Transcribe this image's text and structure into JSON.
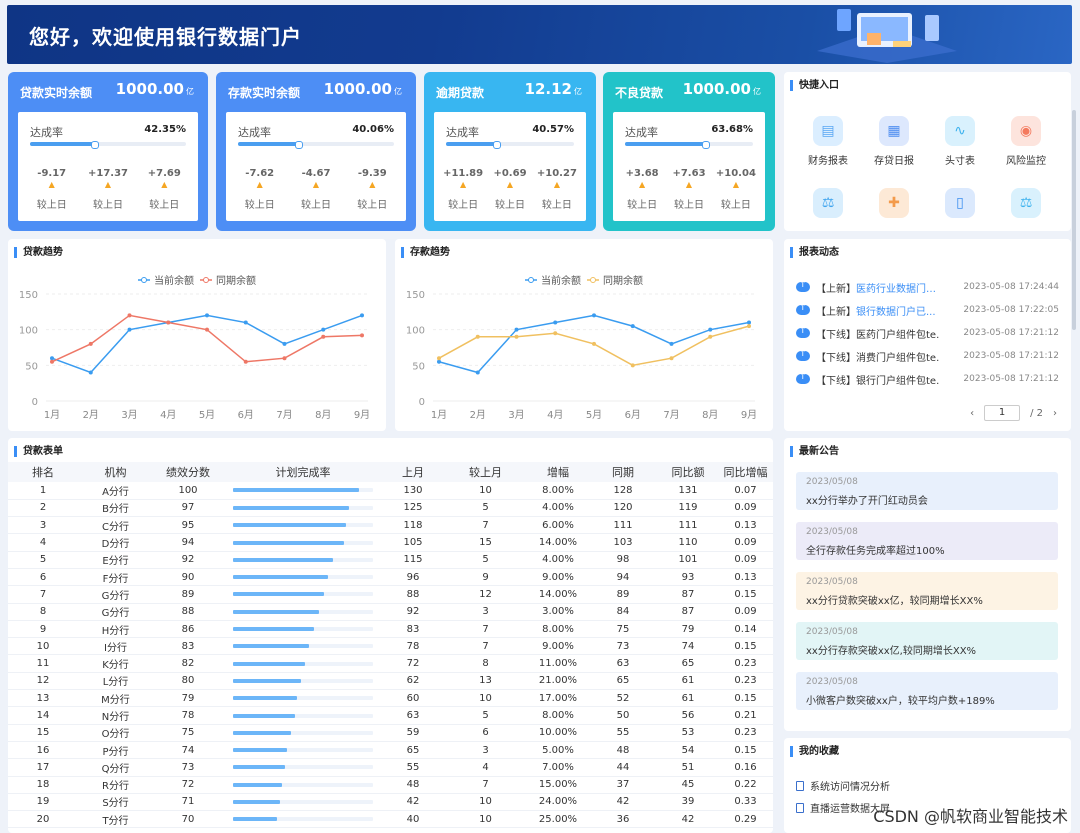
{
  "banner": {
    "greeting": "您好，欢迎使用银行数据门户"
  },
  "kpis": [
    {
      "title": "贷款实时余额",
      "value": "1000.00",
      "unit": "亿",
      "rate_label": "达成率",
      "rate": "42.35%",
      "rate_pct": 42.35,
      "changes": [
        "-9.17",
        "+17.37",
        "+7.69"
      ],
      "change_label": "较上日",
      "bg": "#4d8ef5"
    },
    {
      "title": "存款实时余额",
      "value": "1000.00",
      "unit": "亿",
      "rate_label": "达成率",
      "rate": "40.06%",
      "rate_pct": 40.06,
      "changes": [
        "-7.62",
        "-4.67",
        "-9.39"
      ],
      "change_label": "较上日",
      "bg": "#4d8ef5"
    },
    {
      "title": "逾期贷款",
      "value": "12.12",
      "unit": "亿",
      "rate_label": "达成率",
      "rate": "40.57%",
      "rate_pct": 40.57,
      "changes": [
        "+11.89",
        "+0.69",
        "+10.27"
      ],
      "change_label": "较上日",
      "bg": "#38b6f1"
    },
    {
      "title": "不良贷款",
      "value": "1000.00",
      "unit": "亿",
      "rate_label": "达成率",
      "rate": "63.68%",
      "rate_pct": 63.68,
      "changes": [
        "+3.68",
        "+7.63",
        "+10.04"
      ],
      "change_label": "较上日",
      "bg": "#22c3c9"
    }
  ],
  "quick": {
    "title": "快捷入口",
    "items": [
      {
        "label": "财务报表",
        "icon": "chart-icon",
        "color": "#5aa7f4",
        "bg": "#dbeeff"
      },
      {
        "label": "存贷日报",
        "icon": "calendar-icon",
        "color": "#4f8ef0",
        "bg": "#dde8fd"
      },
      {
        "label": "头寸表",
        "icon": "trend-icon",
        "color": "#3fb3ee",
        "bg": "#d9f1fd"
      },
      {
        "label": "风险监控",
        "icon": "monitor-icon",
        "color": "#f47a5e",
        "bg": "#fde4dd"
      },
      {
        "label": "",
        "icon": "scale-icon",
        "color": "#3fa4ee",
        "bg": "#d9eefd"
      },
      {
        "label": "",
        "icon": "puzzle-icon",
        "color": "#f39a4a",
        "bg": "#fde9d6"
      },
      {
        "label": "",
        "icon": "phone-icon",
        "color": "#3c8ef0",
        "bg": "#dbe9fd"
      },
      {
        "label": "",
        "icon": "scale-icon",
        "color": "#3fb3ee",
        "bg": "#d9f1fd"
      }
    ]
  },
  "loan_trend": {
    "title": "贷款趋势"
  },
  "deposit_trend": {
    "title": "存款趋势"
  },
  "chart_data": [
    {
      "type": "line",
      "categories": [
        "1月",
        "2月",
        "3月",
        "4月",
        "5月",
        "6月",
        "7月",
        "8月",
        "9月"
      ],
      "ylim": [
        0,
        150
      ],
      "yticks": [
        0,
        50,
        100,
        150
      ],
      "series": [
        {
          "name": "当前余额",
          "color": "#3a9cf0",
          "values": [
            60,
            40,
            100,
            110,
            120,
            110,
            80,
            100,
            120
          ]
        },
        {
          "name": "同期余额",
          "color": "#ee7766",
          "values": [
            55,
            80,
            120,
            110,
            100,
            55,
            60,
            90,
            92
          ]
        }
      ]
    },
    {
      "type": "line",
      "categories": [
        "1月",
        "2月",
        "3月",
        "4月",
        "5月",
        "6月",
        "7月",
        "8月",
        "9月"
      ],
      "ylim": [
        0,
        150
      ],
      "yticks": [
        0,
        50,
        100,
        150
      ],
      "series": [
        {
          "name": "当前余额",
          "color": "#3a9cf0",
          "values": [
            55,
            40,
            100,
            110,
            120,
            105,
            80,
            100,
            110
          ]
        },
        {
          "name": "同期余额",
          "color": "#f0c060",
          "values": [
            60,
            90,
            90,
            95,
            80,
            50,
            60,
            90,
            105
          ]
        }
      ]
    }
  ],
  "report": {
    "title": "报表动态",
    "items": [
      {
        "tag": "【上新】",
        "name": "医药行业数据门户...",
        "date": "2023-05-08 17:24:44",
        "link": true
      },
      {
        "tag": "【上新】",
        "name": "银行数据门户已...",
        "date": "2023-05-08 17:22:05",
        "link": true
      },
      {
        "tag": "【下线】",
        "name": "医药门户组件包te...",
        "date": "2023-05-08 17:21:12",
        "link": false
      },
      {
        "tag": "【下线】",
        "name": "消费门户组件包te...",
        "date": "2023-05-08 17:21:12",
        "link": false
      },
      {
        "tag": "【下线】",
        "name": "银行门户组件包te...",
        "date": "2023-05-08 17:21:12",
        "link": false
      }
    ],
    "page": "1",
    "pages": "/ 2",
    "prev": "‹",
    "next": "›"
  },
  "notices": {
    "title": "最新公告",
    "items": [
      {
        "date": "2023/05/08",
        "text": "xx分行举办了开门红动员会",
        "bg": "#e8f0fc"
      },
      {
        "date": "2023/05/08",
        "text": "全行存款任务完成率超过100%",
        "bg": "#ecebf8"
      },
      {
        "date": "2023/05/08",
        "text": "xx分行贷款突破xx亿，较同期增长XX%",
        "bg": "#fdf3e4"
      },
      {
        "date": "2023/05/08",
        "text": "xx分行存款突破xx亿,较同期增长XX%",
        "bg": "#e2f5f6"
      },
      {
        "date": "2023/05/08",
        "text": "小微客户数突破xx户，较平均户数+189%",
        "bg": "#e8f0fc"
      }
    ]
  },
  "favorites": {
    "title": "我的收藏",
    "items": [
      "系统访问情况分析",
      "直播运营数据大屏"
    ]
  },
  "loan_table": {
    "title": "贷款表单",
    "headers": [
      "排名",
      "机构",
      "绩效分数",
      "计划完成率",
      "上月",
      "较上月",
      "增幅",
      "同期",
      "同比额",
      "同比增幅"
    ],
    "rows": [
      [
        "1",
        "A分行",
        "100",
        100,
        "130",
        "10",
        "8.00%",
        "128",
        "131",
        "0.07"
      ],
      [
        "2",
        "B分行",
        "97",
        92,
        "125",
        "5",
        "4.00%",
        "120",
        "119",
        "0.09"
      ],
      [
        "3",
        "C分行",
        "95",
        90,
        "118",
        "7",
        "6.00%",
        "111",
        "111",
        "0.13"
      ],
      [
        "4",
        "D分行",
        "94",
        88,
        "105",
        "15",
        "14.00%",
        "103",
        "110",
        "0.09"
      ],
      [
        "5",
        "E分行",
        "92",
        79,
        "115",
        "5",
        "4.00%",
        "98",
        "101",
        "0.09"
      ],
      [
        "6",
        "F分行",
        "90",
        75,
        "96",
        "9",
        "9.00%",
        "94",
        "93",
        "0.13"
      ],
      [
        "7",
        "G分行",
        "89",
        72,
        "88",
        "12",
        "14.00%",
        "89",
        "87",
        "0.15"
      ],
      [
        "8",
        "G分行",
        "88",
        68,
        "92",
        "3",
        "3.00%",
        "84",
        "87",
        "0.09"
      ],
      [
        "9",
        "H分行",
        "86",
        64,
        "83",
        "7",
        "8.00%",
        "75",
        "79",
        "0.14"
      ],
      [
        "10",
        "I分行",
        "83",
        60,
        "78",
        "7",
        "9.00%",
        "73",
        "74",
        "0.15"
      ],
      [
        "11",
        "K分行",
        "82",
        57,
        "72",
        "8",
        "11.00%",
        "63",
        "65",
        "0.23"
      ],
      [
        "12",
        "L分行",
        "80",
        54,
        "62",
        "13",
        "21.00%",
        "65",
        "61",
        "0.23"
      ],
      [
        "13",
        "M分行",
        "79",
        51,
        "60",
        "10",
        "17.00%",
        "52",
        "61",
        "0.15"
      ],
      [
        "14",
        "N分行",
        "78",
        49,
        "63",
        "5",
        "8.00%",
        "50",
        "56",
        "0.21"
      ],
      [
        "15",
        "O分行",
        "75",
        46,
        "59",
        "6",
        "10.00%",
        "55",
        "53",
        "0.23"
      ],
      [
        "16",
        "P分行",
        "74",
        43,
        "65",
        "3",
        "5.00%",
        "48",
        "54",
        "0.15"
      ],
      [
        "17",
        "Q分行",
        "73",
        41,
        "55",
        "4",
        "7.00%",
        "44",
        "51",
        "0.16"
      ],
      [
        "18",
        "R分行",
        "72",
        39,
        "48",
        "7",
        "15.00%",
        "37",
        "45",
        "0.22"
      ],
      [
        "19",
        "S分行",
        "71",
        37,
        "42",
        "10",
        "24.00%",
        "42",
        "39",
        "0.33"
      ],
      [
        "20",
        "T分行",
        "70",
        35,
        "40",
        "10",
        "25.00%",
        "36",
        "42",
        "0.29"
      ]
    ]
  },
  "watermark": "CSDN @帆软商业智能技术"
}
